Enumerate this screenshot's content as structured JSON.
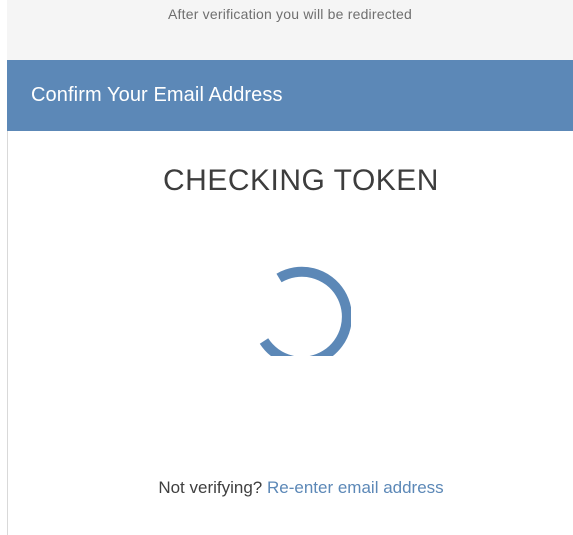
{
  "top_note": "After verification you will be redirected",
  "card": {
    "header_title": "Confirm Your Email Address",
    "status_title": "CHECKING TOKEN",
    "spinner_icon": "loading-spinner-icon",
    "footer_prefix": "Not verifying?",
    "footer_link": "Re-enter email address"
  },
  "colors": {
    "accent": "#5c88b7",
    "text": "#3d3d3d",
    "muted": "#6f6f6f",
    "top_strip": "#f5f5f5"
  }
}
